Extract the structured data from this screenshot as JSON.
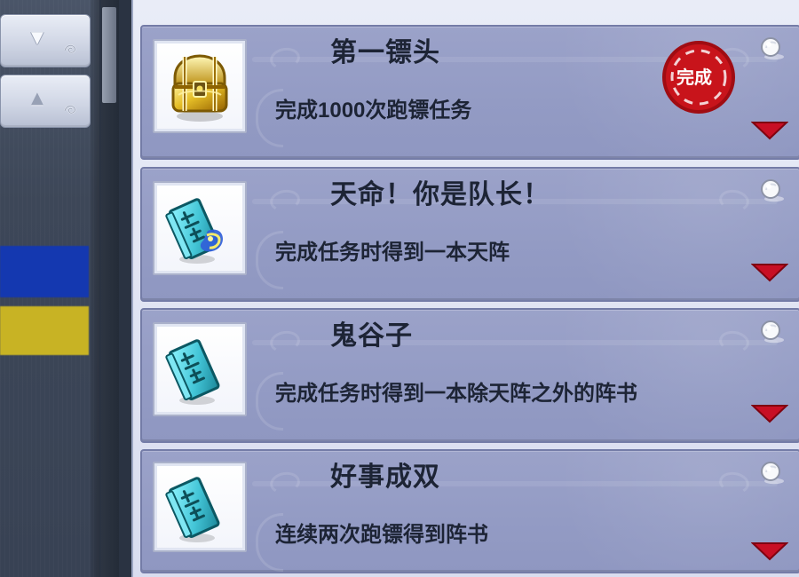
{
  "sidebar": {
    "scroll_down_icon": "triangle-down",
    "scroll_up_icon": "triangle-up",
    "blue_highlight": "#1438b0",
    "yellow_highlight": "#c8b324"
  },
  "achievements": [
    {
      "title": "第一镖头",
      "description": "完成1000次跑镖任务",
      "icon": "treasure-chest-icon",
      "status_stamp": "完成"
    },
    {
      "title": "天命！你是队长！",
      "description": "完成任务时得到一本天阵",
      "icon": "ghost-book-glow-icon"
    },
    {
      "title": "鬼谷子",
      "description": "完成任务时得到一本除天阵之外的阵书",
      "icon": "ghost-book-icon"
    },
    {
      "title": "好事成双",
      "description": "连续两次跑镖得到阵书",
      "icon": "ghost-book-icon"
    }
  ],
  "colors": {
    "card_bg": "#9aa1c8",
    "card_border": "#747ca7",
    "text_dark": "#1d2435",
    "arrow_red": "#c80f24",
    "stamp_red": "#c8141b"
  }
}
